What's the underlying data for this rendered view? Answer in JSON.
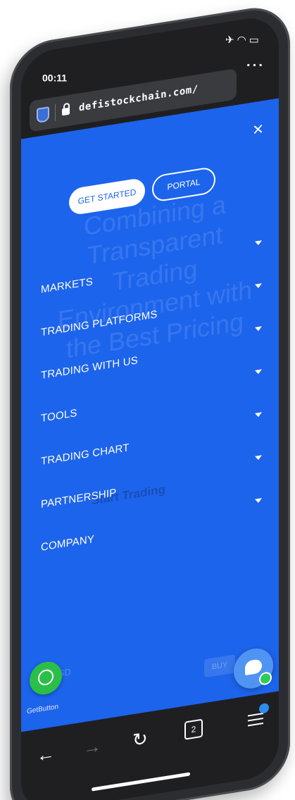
{
  "status": {
    "time": "00:11",
    "icons": [
      "airplane-icon",
      "wifi-icon",
      "battery-icon"
    ]
  },
  "browser": {
    "url": "defistockchain.com/",
    "more_label": "···",
    "tab_count": "2"
  },
  "nav": {
    "close_label": "×",
    "get_started": "GET STARTED",
    "portal": "PORTAL",
    "items": [
      {
        "label": "MARKETS"
      },
      {
        "label": "TRADING PLATFORMS"
      },
      {
        "label": "TRADING WITH US"
      },
      {
        "label": "TOOLS"
      },
      {
        "label": "TRADING CHART"
      },
      {
        "label": "PARTNERSHIP"
      },
      {
        "label": "COMPANY"
      }
    ]
  },
  "background": {
    "headline": "Combining a Transparent Trading Environment with the Best Pricing",
    "cta": "Start Trading",
    "pair": "EURUSD",
    "buy": "BUY"
  },
  "widgets": {
    "getbutton_label": "GetButton"
  },
  "colors": {
    "accent": "#1d64ec",
    "whatsapp": "#2bbf4a",
    "chat": "#4f94f3"
  }
}
